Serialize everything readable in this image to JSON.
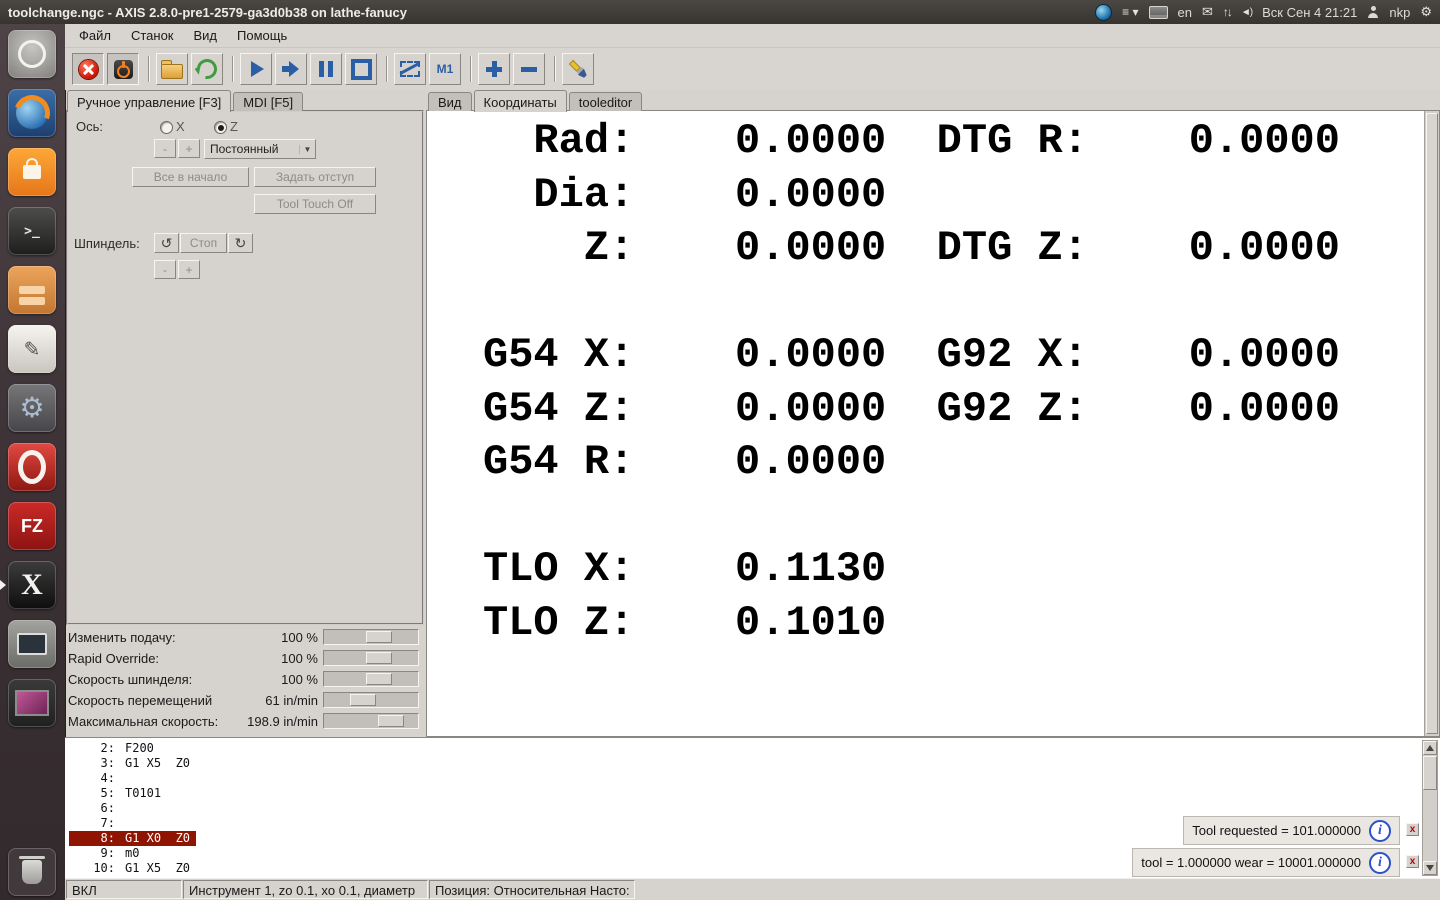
{
  "panel": {
    "title": "toolchange.ngc - AXIS 2.8.0-pre1-2579-ga3d0b38 on lathe-fanucy",
    "keyboard_layout": "en",
    "clock": "Вск Сен 4 21:21",
    "user": "nkp"
  },
  "launcher": {
    "items": [
      "dash-home",
      "firefox",
      "software-center",
      "terminal",
      "file-manager",
      "text-editor",
      "system-settings",
      "opera",
      "filezilla",
      "x-app",
      "terminal-small",
      "image-viewer",
      "trash"
    ]
  },
  "menubar": {
    "items": [
      "Файл",
      "Станок",
      "Вид",
      "Помощь"
    ]
  },
  "toolbar": {
    "buttons": [
      "estop",
      "machine-power",
      "open-file",
      "reload",
      "run",
      "run-from-line",
      "pause",
      "stop",
      "skip-lines",
      "optional-stop",
      "zoom-in",
      "zoom-out",
      "clear-plot"
    ]
  },
  "manual_tab": {
    "tabs": {
      "manual": "Ручное управление [F3]",
      "mdi": "MDI [F5]"
    },
    "axis_label": "Ось:",
    "axis_x": "X",
    "axis_z": "Z",
    "selected_axis": "Z",
    "jog_minus": "-",
    "jog_plus": "+",
    "jog_mode": "Постоянный",
    "home_all_label": "Все в начало",
    "touch_off_label": "Задать отступ",
    "tool_touch_off_label": "Tool Touch Off",
    "spindle_label": "Шпиндель:",
    "spindle_stop_label": "Стоп",
    "spindle_minus": "-",
    "spindle_plus": "+"
  },
  "overrides": {
    "rows": [
      {
        "label": "Изменить подачу:",
        "value": "100 %"
      },
      {
        "label": "Rapid Override:",
        "value": "100 %"
      },
      {
        "label": "Скорость шпинделя:",
        "value": "100 %"
      },
      {
        "label": "Скорость перемещений",
        "value": "61 in/min"
      },
      {
        "label": "Максимальная скорость:",
        "value": "198.9 in/min"
      }
    ]
  },
  "dro": {
    "tabs": [
      "Вид",
      "Координаты",
      "tooleditor"
    ],
    "active_tab": "Координаты",
    "lines": [
      "  Rad:    0.0000  DTG R:    0.0000",
      "  Dia:    0.0000",
      "    Z:    0.0000  DTG Z:    0.0000",
      "",
      "G54 X:    0.0000  G92 X:    0.0000",
      "G54 Z:    0.0000  G92 Z:    0.0000",
      "G54 R:    0.0000",
      "",
      "TLO X:    0.1130",
      "TLO Z:    0.1010"
    ]
  },
  "gcode": {
    "lines": [
      {
        "n": "2:",
        "t": "F200",
        "active": false
      },
      {
        "n": "3:",
        "t": "G1 X5  Z0",
        "active": false
      },
      {
        "n": "4:",
        "t": "",
        "active": false
      },
      {
        "n": "5:",
        "t": "T0101",
        "active": false
      },
      {
        "n": "6:",
        "t": "",
        "active": false
      },
      {
        "n": "7:",
        "t": "",
        "active": false
      },
      {
        "n": "8:",
        "t": "G1 X0  Z0",
        "active": true
      },
      {
        "n": "9:",
        "t": "m0",
        "active": false
      },
      {
        "n": "10:",
        "t": "G1 X5  Z0",
        "active": false
      }
    ]
  },
  "notifications": [
    {
      "text": "Tool requested = 101.000000"
    },
    {
      "text": "tool = 1.000000 wear = 10001.000000"
    }
  ],
  "statusbar": {
    "machine_state": "ВКЛ",
    "tool_info": "Инструмент 1, zo 0.1, xo 0.1, диаметр",
    "position_info": "Позиция: Относительная Насто:"
  },
  "glyphs": {
    "terminal_prompt": ">_",
    "pencil": "✎",
    "gear": "⚙",
    "filezilla": "FZ",
    "x_app": "X",
    "mail": "✉",
    "updown": "↑↓",
    "volume": "◄)",
    "session": "≡ ▾",
    "spindle_ccw": "↺",
    "spindle_cw": "↻",
    "combo_arrow": "▼",
    "m1": "M1",
    "info": "i",
    "close": "x"
  },
  "colors": {
    "accent_blue": "#2b5fa5",
    "active_line_bg": "#8f1502",
    "estop_red": "#cc1400",
    "panel_gray": "#d6d2cd"
  }
}
